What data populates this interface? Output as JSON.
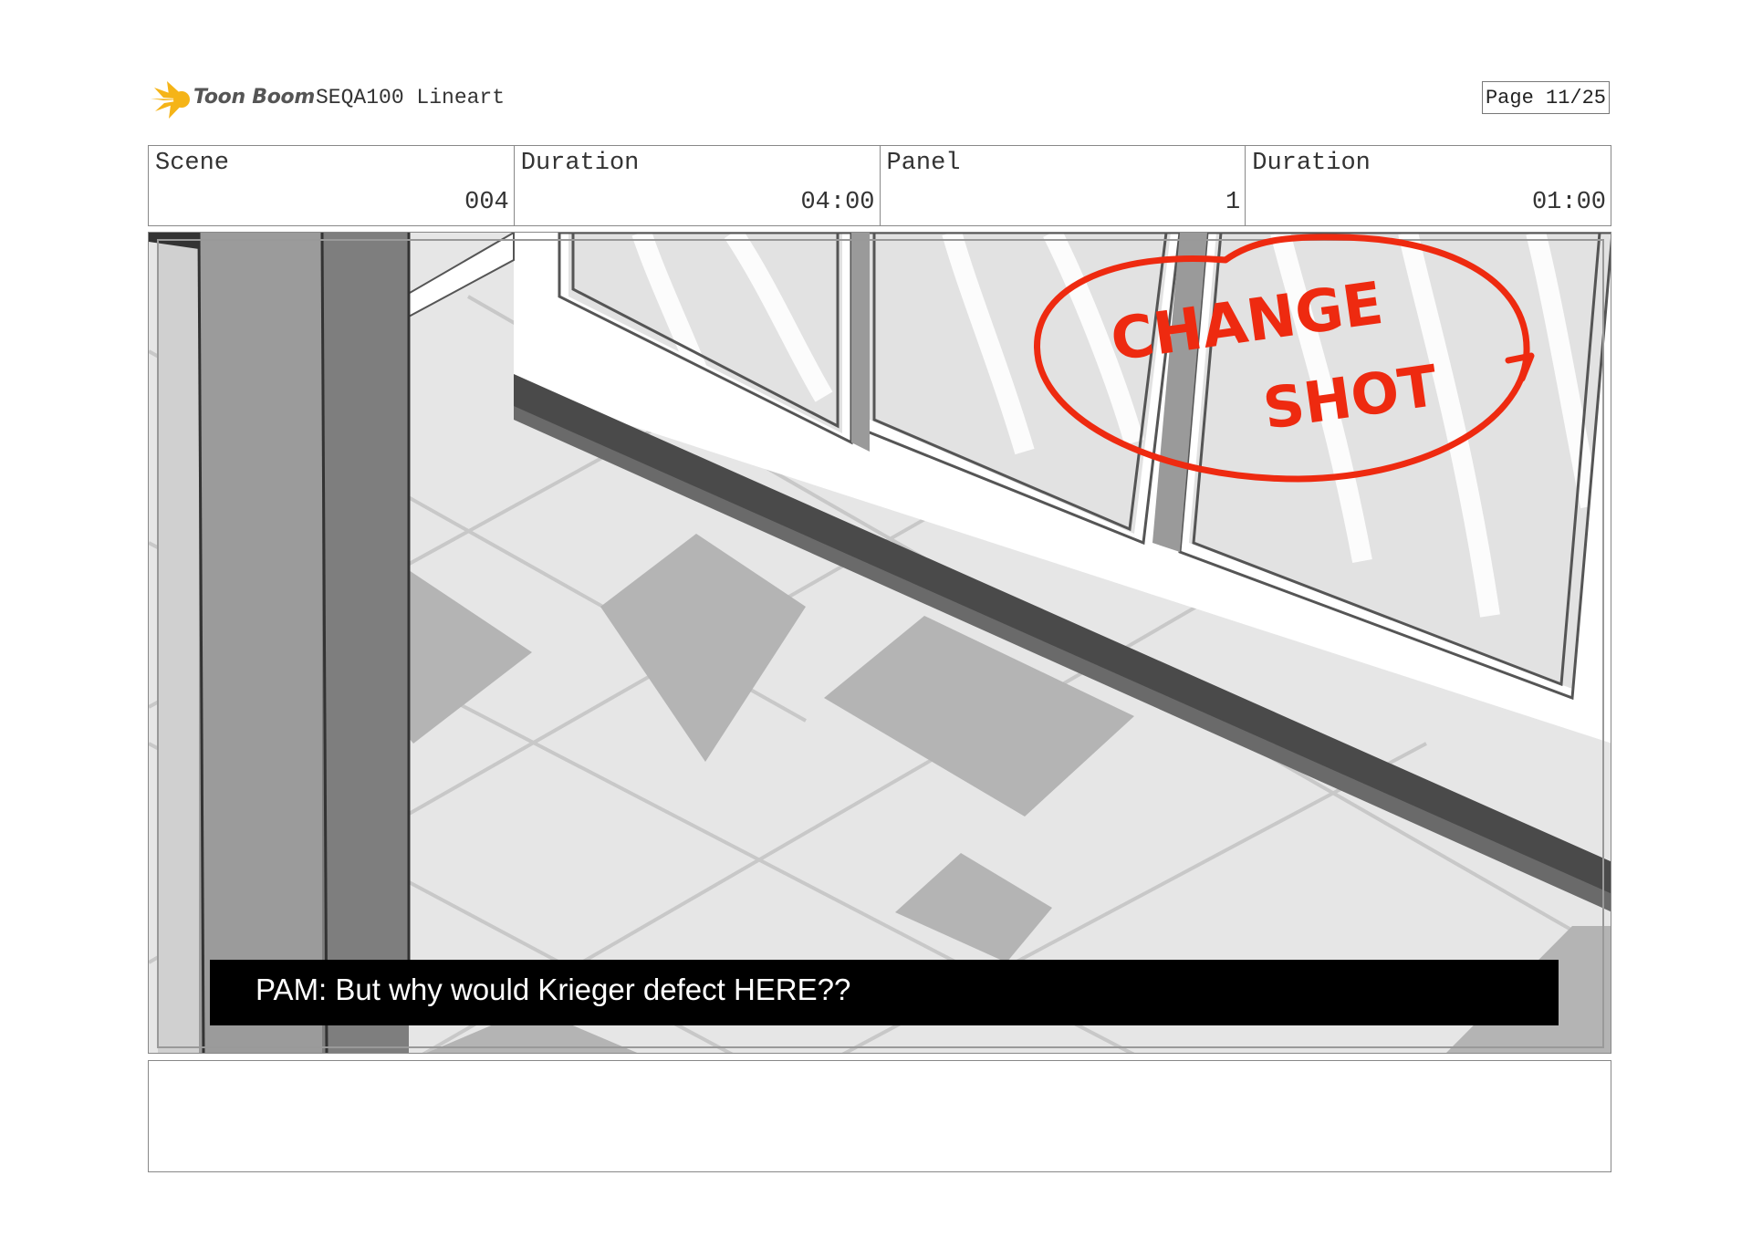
{
  "header": {
    "brand": "Toon Boom",
    "title": "SEQA100 Lineart",
    "page": "Page 11/25"
  },
  "info": {
    "scene_label": "Scene",
    "scene_value": "004",
    "scene_duration_label": "Duration",
    "scene_duration_value": "04:00",
    "panel_label": "Panel",
    "panel_value": "1",
    "panel_duration_label": "Duration",
    "panel_duration_value": "01:00"
  },
  "panel": {
    "caption": "PAM: But why would Krieger defect HERE??",
    "annotation_line1": "CHANGE",
    "annotation_line2": "SHOT"
  },
  "colors": {
    "annotation": "#ee2a10",
    "logo": "#f5b417",
    "caption_bar": "#000000"
  }
}
